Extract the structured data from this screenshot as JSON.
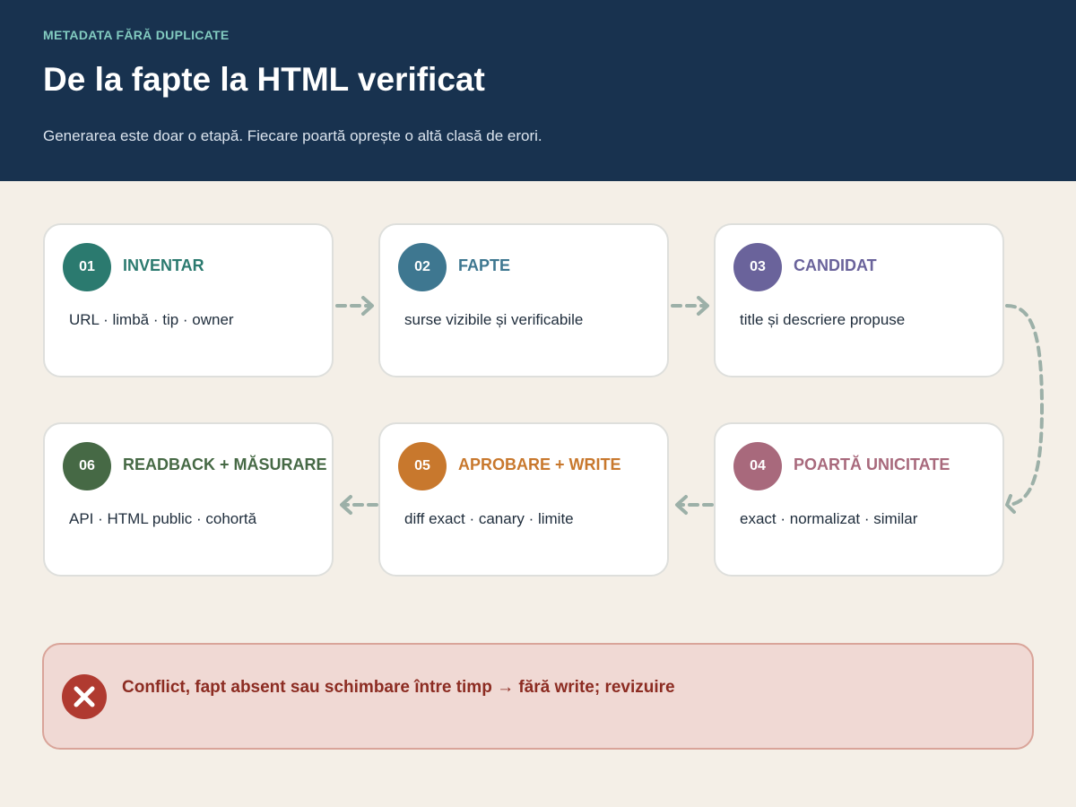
{
  "header": {
    "eyebrow": "METADATA FĂRĂ DUPLICATE",
    "title": "De la fapte la HTML verificat",
    "subtitle": "Generarea este doar o etapă. Fiecare poartă oprește o altă clasă de erori."
  },
  "steps": [
    {
      "number": "01",
      "title": "INVENTAR",
      "description": "URL · limbă · tip · owner",
      "color": "#2b7a6f"
    },
    {
      "number": "02",
      "title": "FAPTE",
      "description": "surse vizibile și verificabile",
      "color": "#3e7790"
    },
    {
      "number": "03",
      "title": "CANDIDAT",
      "description": "title și descriere propuse",
      "color": "#6a639b"
    },
    {
      "number": "04",
      "title": "POARTĂ UNICITATE",
      "description": "exact · normalizat · similar",
      "color": "#a8697c"
    },
    {
      "number": "05",
      "title": "APROBARE + WRITE",
      "description": "diff exact · canary · limite",
      "color": "#c8782d"
    },
    {
      "number": "06",
      "title": "READBACK + MĂSURARE",
      "description": "API · HTML public · cohortă",
      "color": "#466945"
    }
  ],
  "alert": {
    "icon": "close-icon",
    "text": "Conflict, fapt absent sau schimbare între timp → fără write; revizuire",
    "color": "#b03a30"
  },
  "connector_color": "#9cb0a8"
}
